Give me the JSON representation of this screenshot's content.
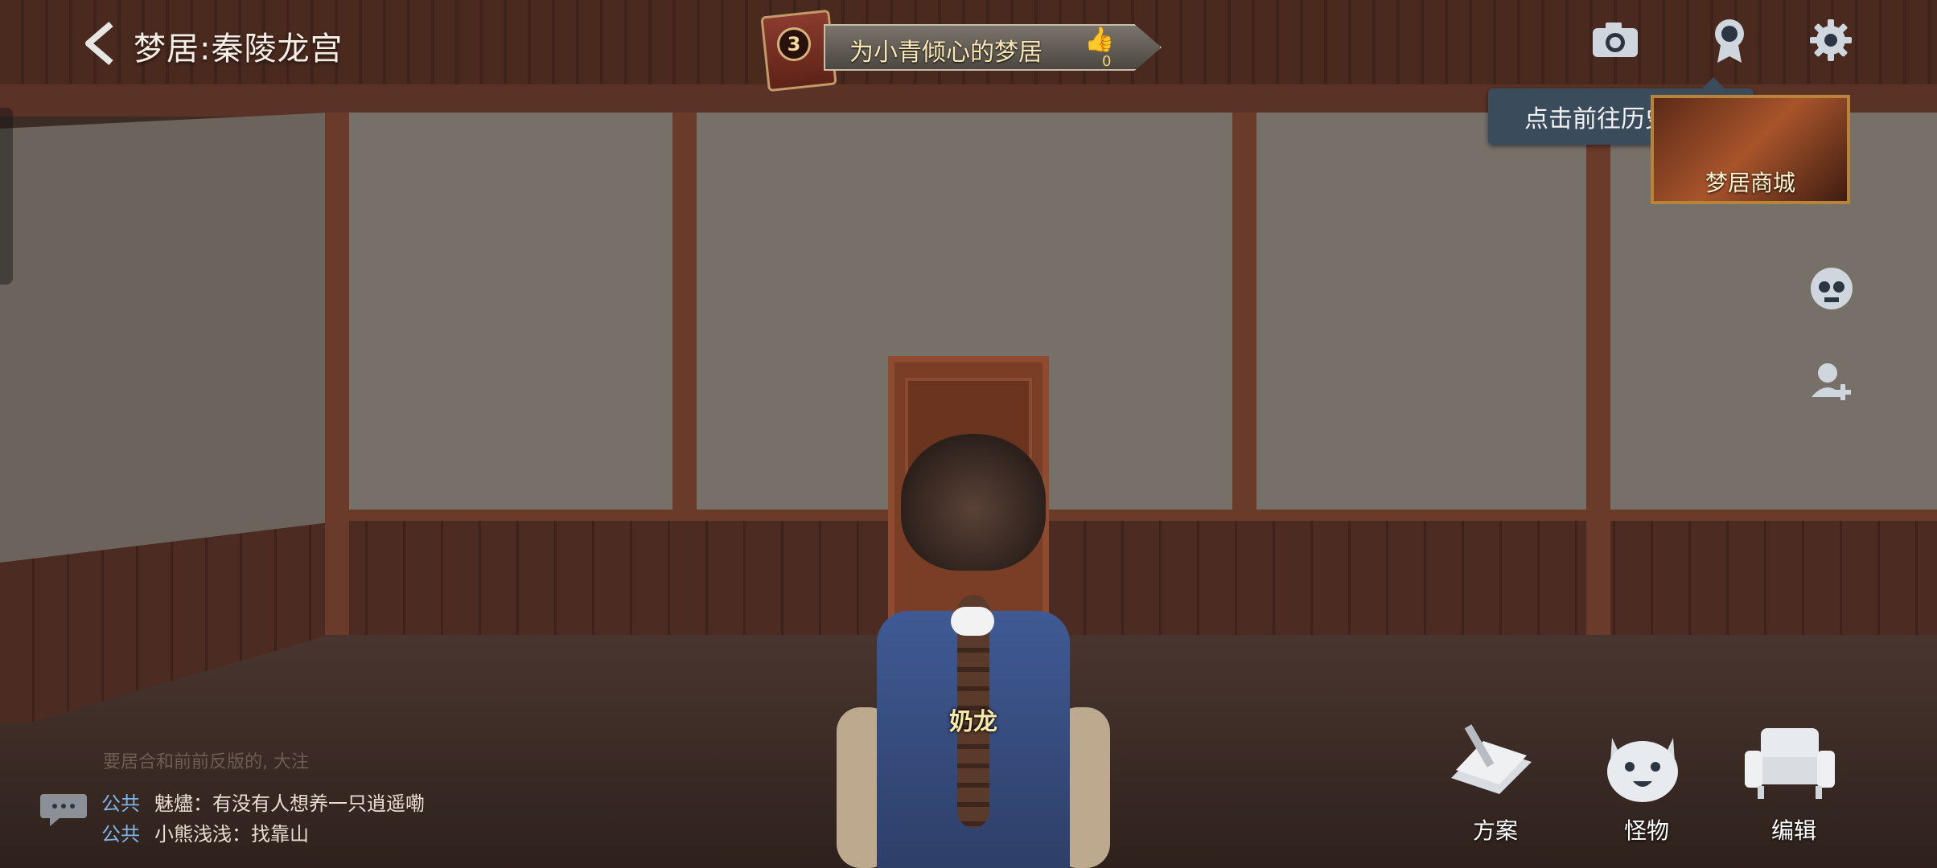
{
  "header": {
    "title": "梦居:秦陵龙宫",
    "banner_level": "3",
    "banner_text": "为小青倾心的梦居",
    "like_count": "0"
  },
  "top_icons": [
    "camera-icon",
    "badge-icon",
    "gear-icon"
  ],
  "tooltip": "点击前往历史梦居",
  "shop": {
    "label": "梦居商城"
  },
  "character": {
    "name": "奶龙"
  },
  "chat": {
    "faded_line": "要居合和前前反版的, 大注",
    "messages": [
      {
        "channel": "公共",
        "text": "魅燼：有没有人想养一只逍遥嘞"
      },
      {
        "channel": "公共",
        "text": "小熊浅浅：找靠山"
      }
    ]
  },
  "bottom_buttons": [
    {
      "label": "方案",
      "icon": "blueprint-icon"
    },
    {
      "label": "怪物",
      "icon": "monster-icon"
    },
    {
      "label": "编辑",
      "icon": "armchair-icon"
    }
  ]
}
